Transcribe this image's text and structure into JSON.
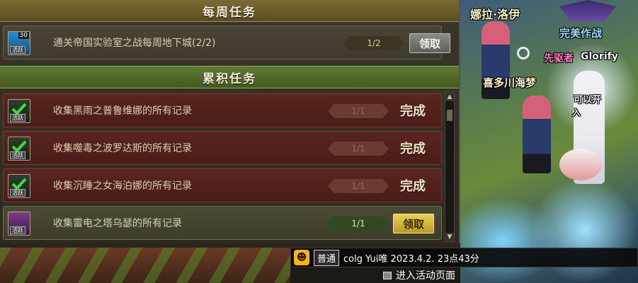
{
  "weekly": {
    "header": "每周任务",
    "quest": {
      "icon_badge": "30",
      "icon_tag": "活跃",
      "text": "通关帝国实验室之战每周地下城(2/2)",
      "progress": "1/2",
      "button": "领取"
    }
  },
  "accumulated": {
    "header": "累积任务",
    "quests": [
      {
        "icon_tag": "活跃",
        "text": "收集黑雨之普鲁维娜的所有记录",
        "progress": "1/1",
        "status": "完成"
      },
      {
        "icon_tag": "活跃",
        "text": "收集噬毒之波罗达斯的所有记录",
        "progress": "1/1",
        "status": "完成"
      },
      {
        "icon_tag": "活跃",
        "text": "收集沉睡之女海泊娜的所有记录",
        "progress": "1/1",
        "status": "完成"
      },
      {
        "icon_tag": "活跃",
        "text": "收集雷电之塔乌瑟的所有记录",
        "progress": "1/1",
        "button": "领取"
      }
    ]
  },
  "scroll": {
    "up": "▲",
    "down": "▼"
  },
  "scene": {
    "name1": "娜拉·洛伊",
    "title_guild": "完美作战",
    "name3_prefix": "先驱者",
    "name3": "Glorify",
    "name4": "喜多川海梦",
    "partial1": "可以开",
    "partial2": "入"
  },
  "chat": {
    "emoji": "☻",
    "channel": "普通",
    "message": "colg Yui唯 2023.4.2. 23点43分"
  },
  "activity_link": "进入活动页面",
  "colors": {
    "weekly_header": "#6b5c2c",
    "accum_header": "#50692a",
    "done_row": "#521f1b",
    "button_gold": "#d4b83b",
    "button_gray": "#75756f"
  }
}
